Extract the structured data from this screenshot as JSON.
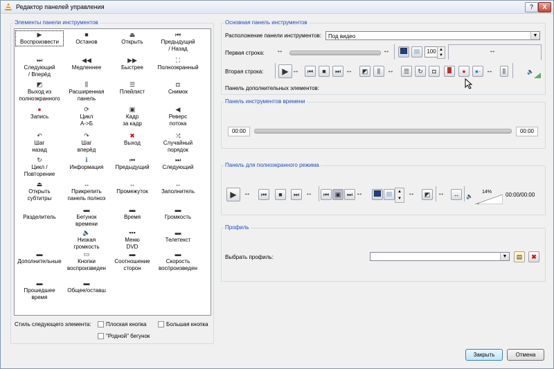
{
  "window": {
    "title": "Редактор панелей управления",
    "help_label": "?",
    "close_label": "X"
  },
  "elements_panel": {
    "title": "Элементы панели инструментов",
    "items": [
      {
        "label": "Воспроизвести",
        "icon": "play-icon",
        "glyph": "▶"
      },
      {
        "label": "Останов",
        "icon": "stop-icon",
        "glyph": "■"
      },
      {
        "label": "Открыть",
        "icon": "eject-icon",
        "glyph": "⏏"
      },
      {
        "label": "Предыдущий\n/ Назад",
        "icon": "previous-icon",
        "glyph": "⏮"
      },
      {
        "label": "Следующий\n/ Вперёд",
        "icon": "next-icon",
        "glyph": "⏭"
      },
      {
        "label": "Медленнее",
        "icon": "slower-icon",
        "glyph": "◀◀"
      },
      {
        "label": "Быстрее",
        "icon": "faster-icon",
        "glyph": "▶▶"
      },
      {
        "label": "Полноэкранный",
        "icon": "fullscreen-icon",
        "glyph": "⛶"
      },
      {
        "label": "Выход из\nполноэкранного",
        "icon": "defullscreen-icon",
        "glyph": "◩"
      },
      {
        "label": "Расширенная\nпанель",
        "icon": "extended-panel-icon",
        "glyph": "⫼"
      },
      {
        "label": "Плейлист",
        "icon": "playlist-icon",
        "glyph": "☰"
      },
      {
        "label": "Снимок",
        "icon": "snapshot-icon",
        "glyph": "◘"
      },
      {
        "label": "Запись",
        "icon": "record-icon",
        "glyph": "●"
      },
      {
        "label": "Цикл\nA->Б",
        "icon": "loop-ab-icon",
        "glyph": "⟳"
      },
      {
        "label": "Кадр\nза кадр",
        "icon": "frame-by-frame-icon",
        "glyph": "▣"
      },
      {
        "label": "Реверс\nпотока",
        "icon": "reverse-icon",
        "glyph": "◀"
      },
      {
        "label": "Шаг\nназад",
        "icon": "step-back-icon",
        "glyph": "↶"
      },
      {
        "label": "Шаг\nвперёд",
        "icon": "step-forward-icon",
        "glyph": "↷"
      },
      {
        "label": "Выход",
        "icon": "quit-icon",
        "glyph": "✖"
      },
      {
        "label": "Случайный\nпорядок",
        "icon": "shuffle-icon",
        "glyph": "⤨"
      },
      {
        "label": "Цикл /\nПовторение",
        "icon": "loop-icon",
        "glyph": "↻"
      },
      {
        "label": "Информация",
        "icon": "info-icon",
        "glyph": "ℹ"
      },
      {
        "label": "Предыдущий",
        "icon": "previous-chapter-icon",
        "glyph": "⏮"
      },
      {
        "label": "Следующий",
        "icon": "next-chapter-icon",
        "glyph": "⏭"
      },
      {
        "label": "Открыть\nсубтитры",
        "icon": "open-subtitles-icon",
        "glyph": "⏏"
      },
      {
        "label": "Прикрепить\nпанель полноэ",
        "icon": "attach-panel-icon",
        "glyph": "↔"
      },
      {
        "label": "Промежуток",
        "icon": "spacer-icon",
        "glyph": "↔"
      },
      {
        "label": "Заполнитель",
        "icon": "expanding-spacer-icon",
        "glyph": "↔"
      },
      {
        "label": "Разделитель",
        "icon": "separator-icon",
        "glyph": ""
      },
      {
        "label": "Бегунок\nвремени",
        "icon": "time-slider-icon",
        "glyph": "▬"
      },
      {
        "label": "Время",
        "icon": "time-icon",
        "glyph": "▬"
      },
      {
        "label": "Громкость",
        "icon": "volume-icon",
        "glyph": "▬"
      },
      {
        "label": "",
        "icon": "blank-icon",
        "glyph": ""
      },
      {
        "label": "Низкая\nгромкость",
        "icon": "low-volume-icon",
        "glyph": "🔈"
      },
      {
        "label": "Меню\nDVD",
        "icon": "dvd-menu-icon",
        "glyph": "▪▪▪"
      },
      {
        "label": "Телетекст",
        "icon": "teletext-icon",
        "glyph": "▬"
      },
      {
        "label": "Дополнительные",
        "icon": "advanced-icon",
        "glyph": "▬"
      },
      {
        "label": "Кнопки\nвоспроизведен",
        "icon": "playback-buttons-icon",
        "glyph": "▭"
      },
      {
        "label": "Соотношение\nсторон",
        "icon": "aspect-ratio-icon",
        "glyph": "▬"
      },
      {
        "label": "Скорость\nвоспроизведен",
        "icon": "speed-icon",
        "glyph": "▬"
      },
      {
        "label": "Прошедшее\nвремя",
        "icon": "elapsed-time-icon",
        "glyph": "▬"
      },
      {
        "label": "Общее/оставш",
        "icon": "remaining-time-icon",
        "glyph": "▬"
      }
    ],
    "style_label": "Стиль следующего элемента:",
    "flat_button": "Плоская кнопка",
    "big_button": "Большая кнопка",
    "native_slider": "\"Родной\" бегунок"
  },
  "main_panel": {
    "title": "Основная панель инструментов",
    "position_label": "Расположение панели инструментов:",
    "position_value": "Под видео",
    "first_row_label": "Первая строка:",
    "zoom_value": "100",
    "second_row_label": "Вторая строка:",
    "extra_label": "Панель дополнительных элементов:"
  },
  "time_panel": {
    "title": "Панель инструментов времени",
    "elapsed": "00:00",
    "total": "00:00"
  },
  "fullscreen_panel": {
    "title": "Панель для полноэкранного режима",
    "volume_percent": "14%",
    "time": "00:00/00:00"
  },
  "profile_panel": {
    "title": "Профиль",
    "select_label": "Выбрать профиль:",
    "value": ""
  },
  "buttons": {
    "close": "Закрыть",
    "cancel": "Отмена"
  }
}
